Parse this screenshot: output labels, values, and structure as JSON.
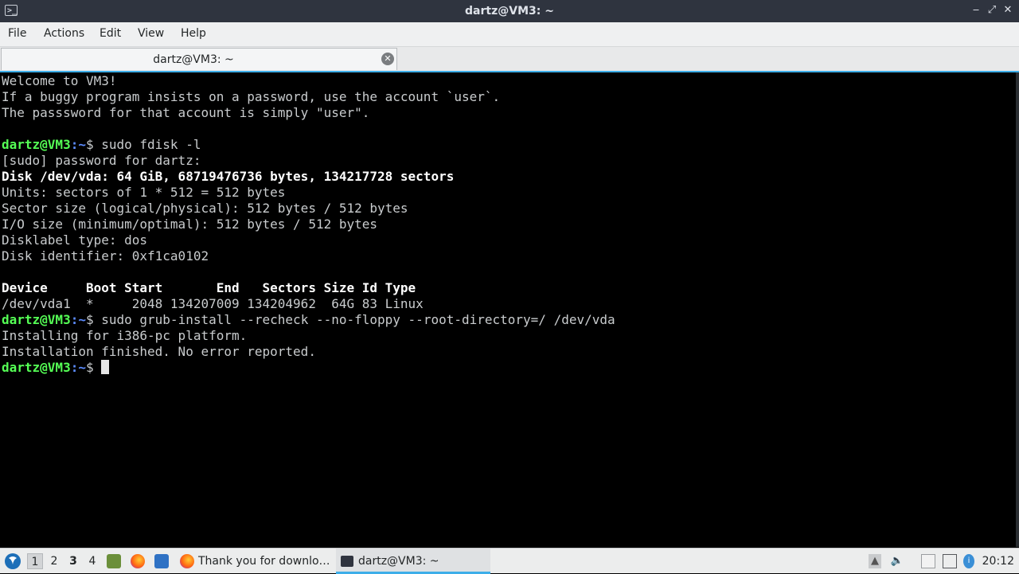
{
  "window": {
    "title": "dartz@VM3: ~",
    "controls": {
      "minimize": "‒",
      "restore": "⤢",
      "close": "✕"
    }
  },
  "menu": {
    "items": [
      "File",
      "Actions",
      "Edit",
      "View",
      "Help"
    ]
  },
  "tab": {
    "label": "dartz@VM3: ~"
  },
  "terminal": {
    "lines": [
      {
        "text": "Welcome to VM3!"
      },
      {
        "text": "If a buggy program insists on a password, use the account `user`."
      },
      {
        "text": "The passsword for that account is simply \"user\"."
      },
      {
        "text": ""
      },
      {
        "prompt_user": "dartz@VM3",
        "prompt_path": ":~",
        "prompt_sym": "$ ",
        "command": "sudo fdisk -l"
      },
      {
        "text": "[sudo] password for dartz:"
      },
      {
        "text": "Disk /dev/vda: 64 GiB, 68719476736 bytes, 134217728 sectors",
        "bold": true
      },
      {
        "text": "Units: sectors of 1 * 512 = 512 bytes"
      },
      {
        "text": "Sector size (logical/physical): 512 bytes / 512 bytes"
      },
      {
        "text": "I/O size (minimum/optimal): 512 bytes / 512 bytes"
      },
      {
        "text": "Disklabel type: dos"
      },
      {
        "text": "Disk identifier: 0xf1ca0102"
      },
      {
        "text": ""
      },
      {
        "text": "Device     Boot Start       End   Sectors Size Id Type",
        "bold": true
      },
      {
        "text": "/dev/vda1  *     2048 134207009 134204962  64G 83 Linux"
      },
      {
        "prompt_user": "dartz@VM3",
        "prompt_path": ":~",
        "prompt_sym": "$ ",
        "command": "sudo grub-install --recheck --no-floppy --root-directory=/ /dev/vda"
      },
      {
        "text": "Installing for i386-pc platform."
      },
      {
        "text": "Installation finished. No error reported."
      },
      {
        "prompt_user": "dartz@VM3",
        "prompt_path": ":~",
        "prompt_sym": "$ ",
        "command": "",
        "cursor": true
      }
    ],
    "colors": {
      "user": "#55ff55",
      "path": "#5c8cff",
      "text": "#c9ccce",
      "background": "#000000"
    }
  },
  "taskbar": {
    "desktops": [
      "1",
      "2",
      "3",
      "4"
    ],
    "tasks": [
      {
        "label": "Thank you for downlo…",
        "icon": "firefox-icon"
      },
      {
        "label": "dartz@VM3: ~",
        "icon": "terminal-icon",
        "active": true
      }
    ],
    "clock": "20:12"
  }
}
